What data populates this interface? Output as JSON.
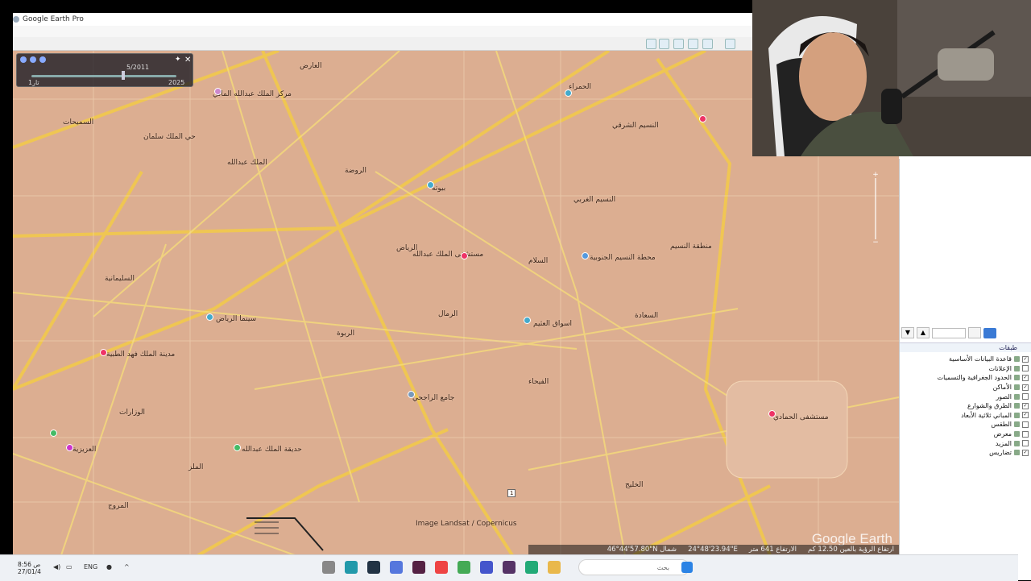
{
  "window": {
    "title": "Google Earth Pro"
  },
  "history": {
    "date": "5/2011",
    "year_start": "1ﺗﺎﺭ",
    "year_end": "2025"
  },
  "map": {
    "labels": [
      "العارض",
      "مركز الملك عبدالله المالي",
      "الحمراء",
      "ﺍﻟﺴﻤﻴﺤﺎﺕ",
      "حي الملك سلمان",
      "ﺍﻟﻨﺴﻴﻢ ﺍﻟﺸﺮﻗﻲ",
      "ﺍﻟﻤﻠﻚ ﻋﺒﺪﺍﻟﻠﻪ",
      "ﺍﻟﺮﻭﺿﺔ",
      "ﺑﻴﻮﺗﻪ",
      "ﺍﻟﻨﺴﻴﻢ ﺍﻟﻐﺮﺑﻲ",
      "ﺍﻟﺮﻳﺎﺽ",
      "ﻣﺴﺘﺸﻔﻰ ﺍﻟﻤﻠﻚ ﻋﺒﺪﺍﻟﻠﻪ",
      "ﺍﻟﺴﻼﻡ",
      "ﻣﻨﻄﻘﺔ ﺍﻟﻨﺴﻴﻢ",
      "ﻣﺤﻄﺔ ﺍﻟﻨﺴﻴﻢ ﺍﻟﺠﻨﻮﺑﻴﺔ",
      "ﺍﻟﺴﻠﻴﻤﺎﻧﻴﺔ",
      "ﺳﻴﻨﻤﺎ ﺍﻟﺮﻳﺎﺽ",
      "ﺍﻟﺮﻣﺎﻝ",
      "ﺍﻟﺮﺑﻮﺓ",
      "ﺍﺳﻮﺍﻕ ﺍﻟﻌﺜﻴﻢ",
      "ﺍﻟﺴﻌﺎﺩﺓ",
      "ﻣﺪﻳﻨﺔ ﺍﻟﻤﻠﻚ ﻓﻬﺪ ﺍﻟﻄﺒﻴﺔ",
      "ﺍﻟﻔﻴﺤﺎﺀ",
      "ﺟﺎﻣﻊ ﺍﻟﺮﺍﺟﺤﻲ",
      "ﺍﻟﻮﺯﺍﺭﺍﺕ",
      "ﻣﺴﺘﺸﻔﻰ ﺍﻟﺤﻤﺎﺩﻱ",
      "ﺣﺪﻳﻘﺔ ﺍﻟﻤﻠﻚ ﻋﺒﺪﺍﻟﻠﻪ",
      "ﺍﻟﻤﻠﺰ",
      "ﺍﻟﻤﺮﻭﺝ",
      "ﺍﻟﻌﺰﻳﺰﻳﺔ",
      "ﺍﻟﺨﻠﻴﺞ",
      "Image Landsat / Copernicus"
    ],
    "logo": "Google Earth",
    "road_sign": "1"
  },
  "status": {
    "alt": "ارتفاع الرؤية بالعين 12.50 كم",
    "elev": "الارتفاع 641 متر",
    "lon": "24°48'23.94\"E",
    "lat": "46°44'57.80\"N شمال"
  },
  "sidebar": {
    "layers_title": "طبقات",
    "layers": [
      {
        "label": "قاعدة البيانات الأساسية",
        "checked": true
      },
      {
        "label": "الإعلانات",
        "checked": false
      },
      {
        "label": "الحدود الجغرافية والتسميات",
        "checked": true
      },
      {
        "label": "الأماكن",
        "checked": true
      },
      {
        "label": "الصور",
        "checked": false
      },
      {
        "label": "الطرق والشوارع",
        "checked": true
      },
      {
        "label": "المباني ثلاثية الأبعاد",
        "checked": true
      },
      {
        "label": "الطقس",
        "checked": false
      },
      {
        "label": "معرض",
        "checked": false
      },
      {
        "label": "المزيد",
        "checked": false
      },
      {
        "label": "تضاريس",
        "checked": true
      }
    ]
  },
  "taskbar": {
    "search_placeholder": "بحث",
    "lang": "ENG",
    "time": "ص 8:56",
    "date": "27/01/4"
  }
}
